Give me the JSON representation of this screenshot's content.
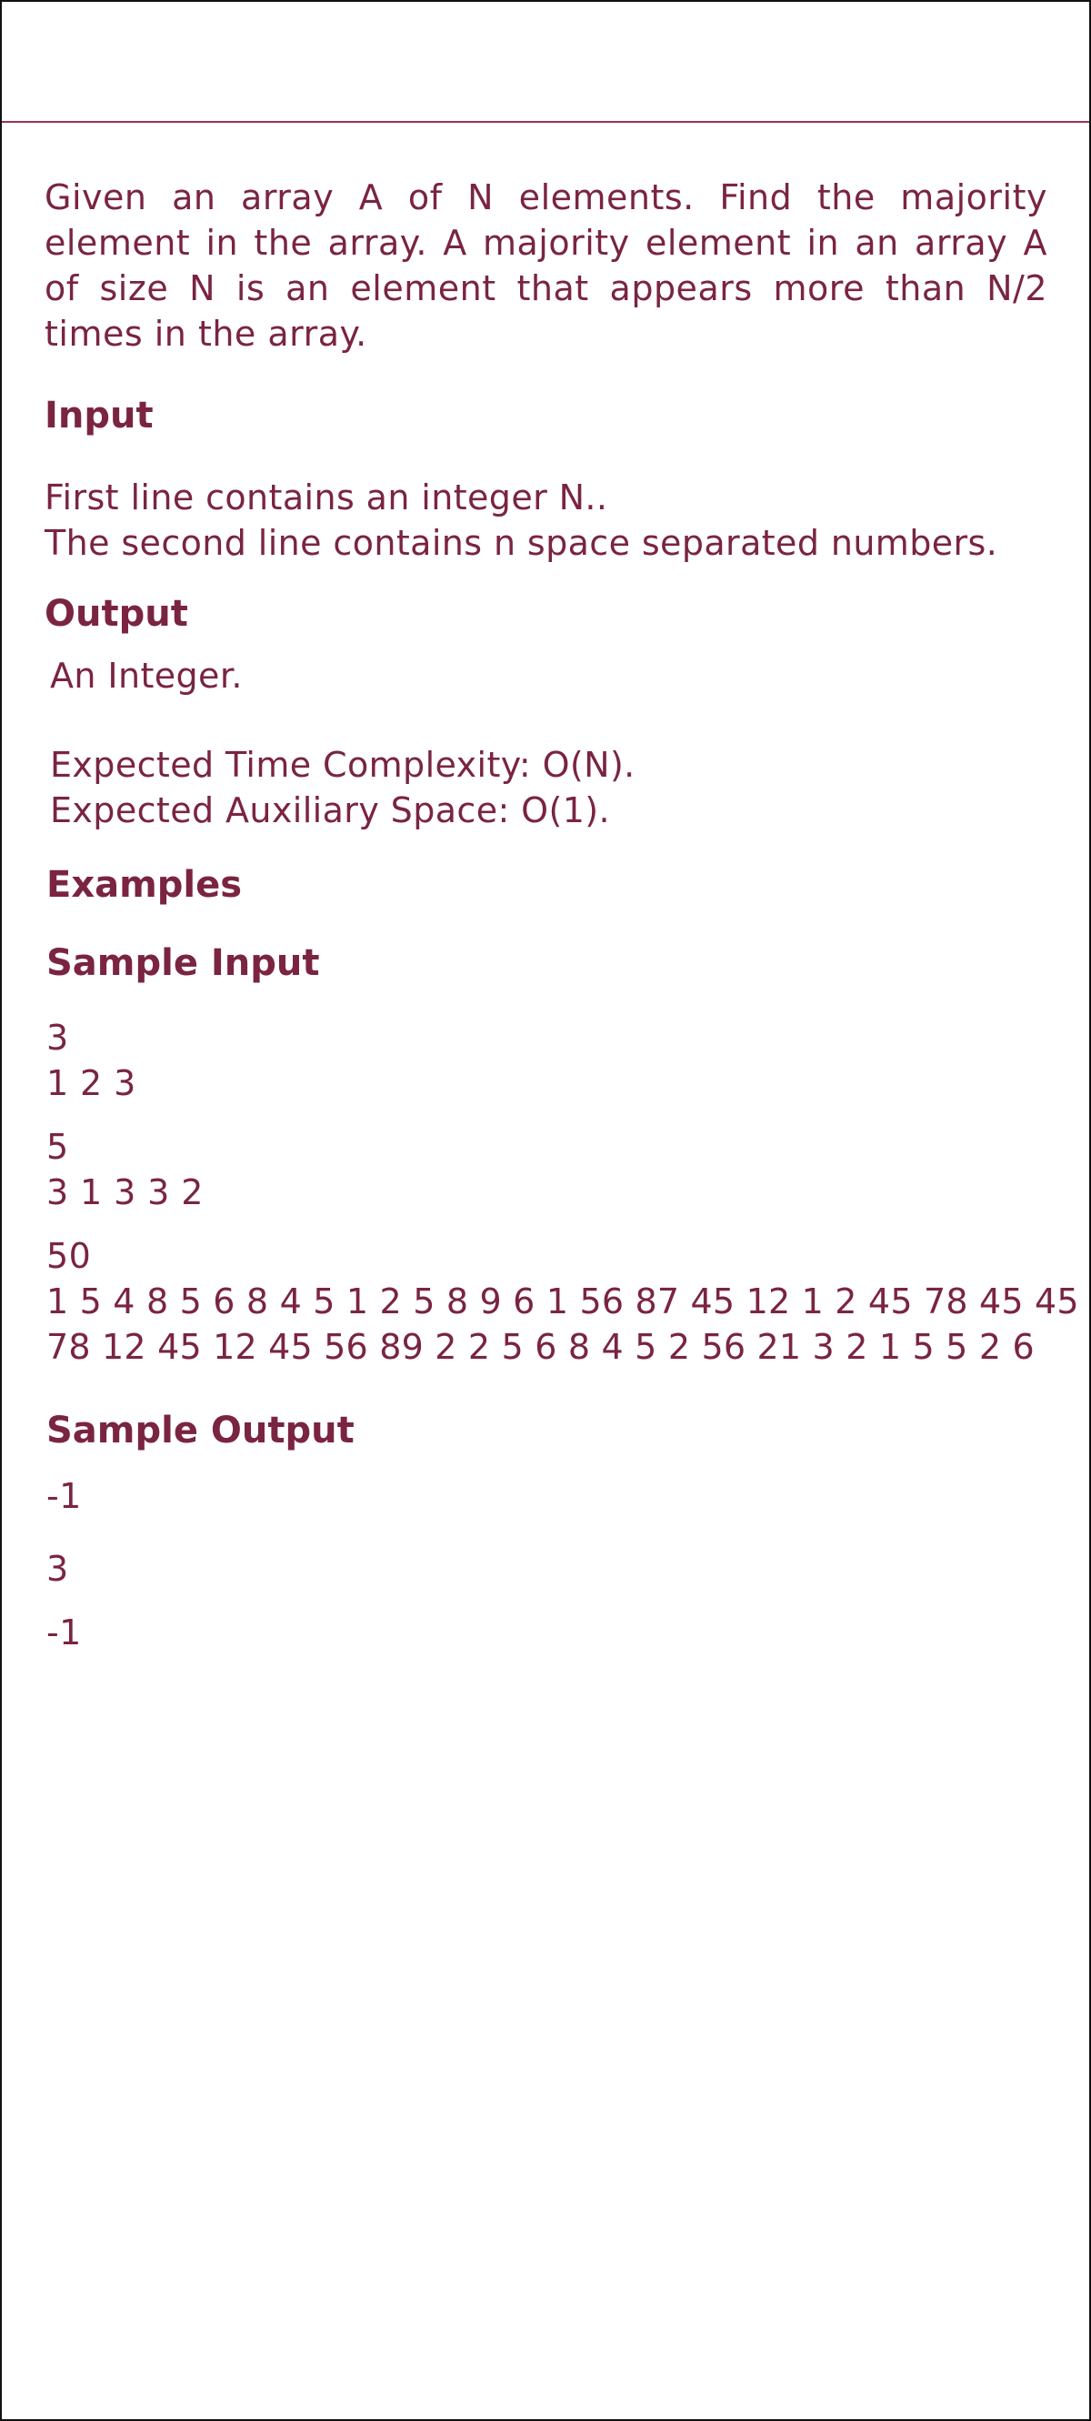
{
  "problem": {
    "description": "Given an array A of N elements. Find the majority element in the array. A majority element in an array A of size N is an element that appears more than N/2 times in the array.",
    "input_heading": "Input",
    "input_lines": [
      "First line contains an integer N..",
      "The second line contains n space separated numbers."
    ],
    "output_heading": "Output",
    "output_text": "An Integer.",
    "complexity_lines": [
      "Expected Time Complexity: O(N).",
      "Expected Auxiliary Space: O(1)."
    ],
    "examples_heading": "Examples",
    "sample_input_heading": "Sample Input",
    "sample_inputs": [
      [
        "3",
        "1 2 3"
      ],
      [
        "5",
        "3 1 3 3 2"
      ],
      [
        "50",
        "1 5 4 8 5 6 8 4 5 1 2 5 8 9 6 1 56 87 45 12 1 2 45 78 45 45",
        "78 12 45 12 45 56 89 2 2 5 6 8 4 5 2 56 21 3 2 1 5 5 2 6"
      ]
    ],
    "sample_output_heading": "Sample Output",
    "sample_outputs": [
      "-1",
      "3",
      "-1"
    ]
  }
}
